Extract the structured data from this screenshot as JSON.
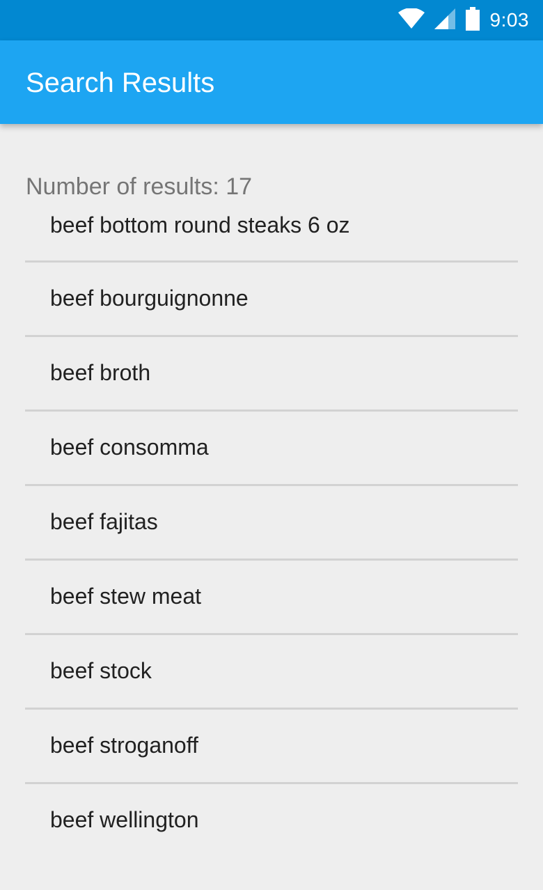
{
  "status_bar": {
    "time": "9:03",
    "icons": [
      "wifi-icon",
      "cell-signal-icon",
      "battery-icon"
    ],
    "color": "#0288d1"
  },
  "app_bar": {
    "title": "Search Results",
    "color": "#1da5f2"
  },
  "results": {
    "count_text": "Number of results: 17",
    "items": [
      {
        "label": "beef bottom round steaks 6 oz"
      },
      {
        "label": "beef bourguignonne"
      },
      {
        "label": "beef broth"
      },
      {
        "label": "beef consomma"
      },
      {
        "label": "beef fajitas"
      },
      {
        "label": "beef stew meat"
      },
      {
        "label": "beef stock"
      },
      {
        "label": "beef stroganoff"
      },
      {
        "label": "beef wellington"
      }
    ]
  }
}
